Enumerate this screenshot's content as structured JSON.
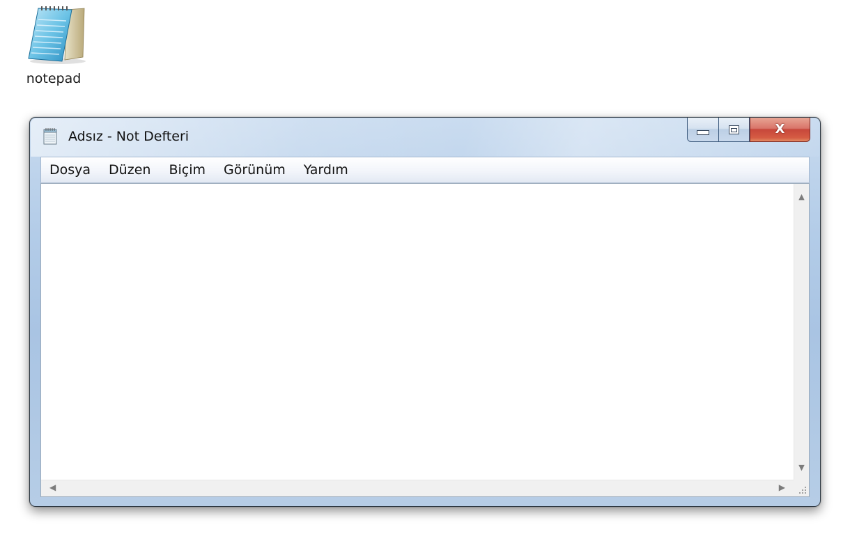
{
  "desktop": {
    "icon_label": "notepad"
  },
  "window": {
    "title": "Adsız - Not Defteri",
    "caption_buttons": {
      "minimize_icon": "minimize-icon",
      "maximize_icon": "maximize-icon",
      "close_icon": "close-icon",
      "close_glyph": "X"
    }
  },
  "menubar": {
    "items": [
      "Dosya",
      "Düzen",
      "Biçim",
      "Görünüm",
      "Yardım"
    ]
  },
  "editor": {
    "content": ""
  },
  "scrollbars": {
    "up_icon": "scroll-up-arrow-icon",
    "down_icon": "scroll-down-arrow-icon",
    "left_icon": "scroll-left-arrow-icon",
    "right_icon": "scroll-right-arrow-icon"
  },
  "colors": {
    "frame": "#b3cce8",
    "close_button": "#c7473b",
    "scrollbar": "#f0f0f0"
  }
}
